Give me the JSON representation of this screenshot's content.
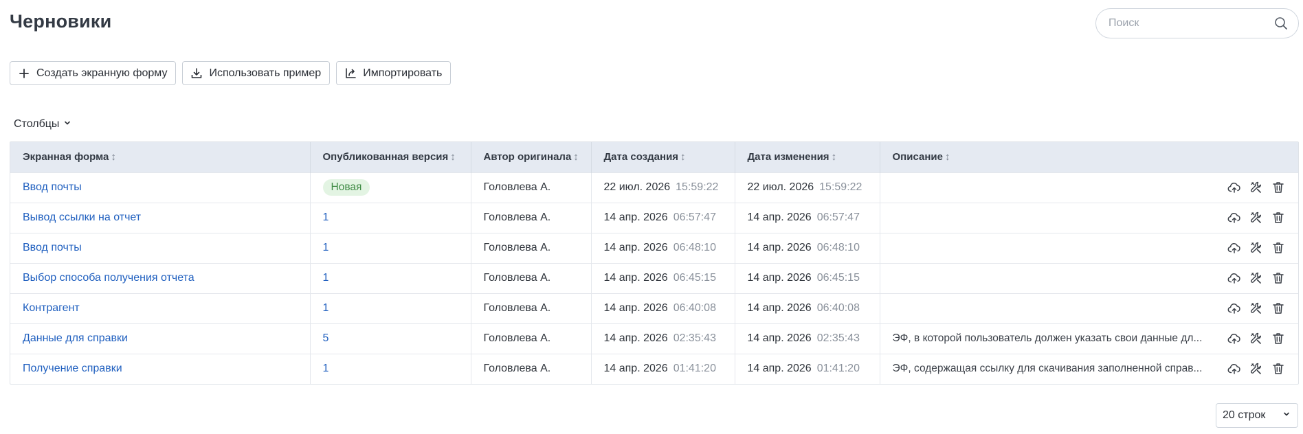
{
  "page": {
    "title": "Черновики"
  },
  "search": {
    "placeholder": "Поиск",
    "value": ""
  },
  "toolbar": {
    "create_label": "Создать экранную форму",
    "example_label": "Использовать пример",
    "import_label": "Импортировать"
  },
  "columns_toggle": {
    "label": "Столбцы"
  },
  "table": {
    "headers": {
      "form": "Экранная форма",
      "version": "Опубликованная версия",
      "author": "Автор оригинала",
      "created": "Дата создания",
      "modified": "Дата изменения",
      "description": "Описание"
    },
    "rows": [
      {
        "form": "Ввод почты",
        "version": "Новая",
        "version_is_new": true,
        "author": "Головлева А.",
        "created_date": "22 июл. 2026",
        "created_time": "15:59:22",
        "modified_date": "22 июл. 2026",
        "modified_time": "15:59:22",
        "description": ""
      },
      {
        "form": "Вывод ссылки на отчет",
        "version": "1",
        "author": "Головлева А.",
        "created_date": "14 апр. 2026",
        "created_time": "06:57:47",
        "modified_date": "14 апр. 2026",
        "modified_time": "06:57:47",
        "description": ""
      },
      {
        "form": "Ввод почты",
        "version": "1",
        "author": "Головлева А.",
        "created_date": "14 апр. 2026",
        "created_time": "06:48:10",
        "modified_date": "14 апр. 2026",
        "modified_time": "06:48:10",
        "description": ""
      },
      {
        "form": "Выбор способа получения отчета",
        "version": "1",
        "author": "Головлева А.",
        "created_date": "14 апр. 2026",
        "created_time": "06:45:15",
        "modified_date": "14 апр. 2026",
        "modified_time": "06:45:15",
        "description": ""
      },
      {
        "form": "Контрагент",
        "version": "1",
        "author": "Головлева А.",
        "created_date": "14 апр. 2026",
        "created_time": "06:40:08",
        "modified_date": "14 апр. 2026",
        "modified_time": "06:40:08",
        "description": ""
      },
      {
        "form": "Данные для справки",
        "version": "5",
        "author": "Головлева А.",
        "created_date": "14 апр. 2026",
        "created_time": "02:35:43",
        "modified_date": "14 апр. 2026",
        "modified_time": "02:35:43",
        "description": "ЭФ, в которой пользователь должен указать свои данные дл..."
      },
      {
        "form": "Получение справки",
        "version": "1",
        "author": "Головлева А.",
        "created_date": "14 апр. 2026",
        "created_time": "01:41:20",
        "modified_date": "14 апр. 2026",
        "modified_time": "01:41:20",
        "description": "ЭФ, содержащая ссылку для скачивания заполненной справ..."
      }
    ],
    "row_actions": [
      "cloud-upload-icon",
      "edit-tools-icon",
      "trash-icon"
    ]
  },
  "pagination": {
    "rows_per_page_label": "20 строк"
  },
  "colors": {
    "link": "#1f5fbf",
    "header_bg": "#e5eaf2",
    "badge_bg": "#e3f4e3",
    "badge_text": "#3e8a44"
  }
}
